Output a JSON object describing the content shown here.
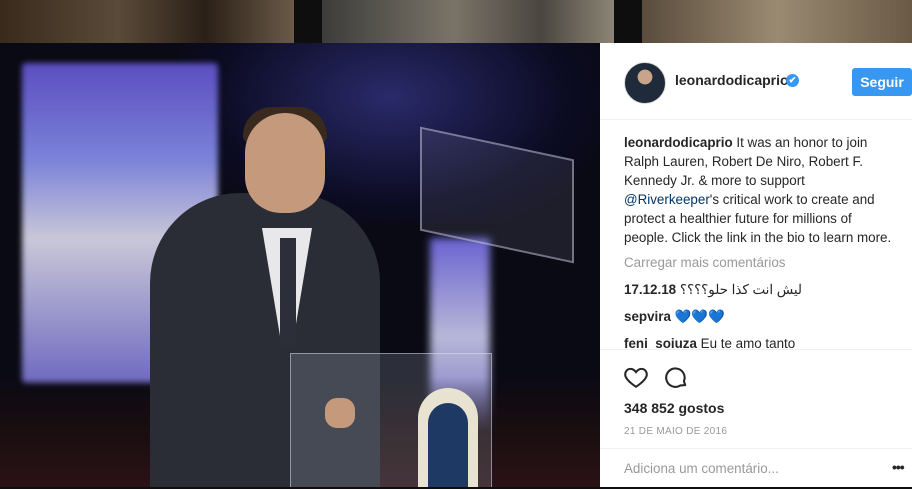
{
  "post": {
    "username": "leonardodicaprio",
    "verified_badge": "✔",
    "follow_label": "Seguir",
    "caption_user": "leonardodicaprio",
    "caption_part1": " It was an honor to join Ralph Lauren, Robert De Niro, Robert F. Kennedy Jr. & more to support ",
    "caption_mention": "@Riverkeeper",
    "caption_part2": "'s critical work to create and protect a healthier future for millions of people. Click the link in the bio to learn more.",
    "load_more_label": "Carregar mais comentários",
    "comments": [
      {
        "user": "17.12.18",
        "text": "ليش انت كذا حلو؟؟؟؟"
      },
      {
        "user": "sepvira",
        "text": "💙💙💙"
      },
      {
        "user": "feni_sojuza",
        "text": "Eu te amo tanto"
      }
    ],
    "likes": "348 852 gostos",
    "date": "21 DE MAIO DE 2016",
    "add_comment_placeholder": "Adiciona um comentário...",
    "more_options": "•••"
  },
  "icons": {
    "like": "heart-icon",
    "comment": "comment-icon",
    "verified": "verified-icon",
    "more": "more-options-icon"
  },
  "colors": {
    "accent": "#3897f0",
    "text": "#262626",
    "muted": "#999999",
    "mention": "#003569"
  }
}
